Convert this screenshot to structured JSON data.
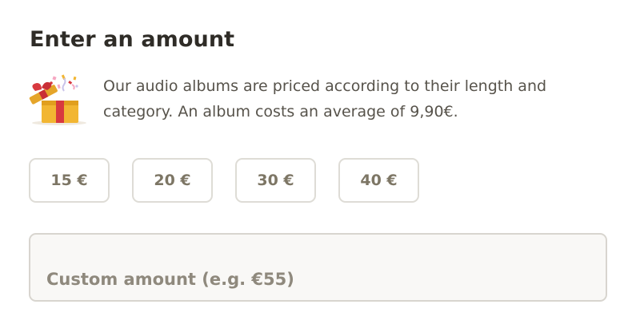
{
  "heading": "Enter an amount",
  "info": {
    "icon": "gift-box-icon",
    "text": "Our audio albums are priced according to their length and category. An album costs an average of 9,90€."
  },
  "amount_options": [
    {
      "label": "15 €"
    },
    {
      "label": "20 €"
    },
    {
      "label": "30 €"
    },
    {
      "label": "40 €"
    }
  ],
  "custom_amount": {
    "value": "",
    "placeholder": "Custom amount (e.g. €55)"
  },
  "colors": {
    "title_text": "#2f2c27",
    "body_text": "#57534b",
    "button_text": "#7d7665",
    "border": "#dedcd6",
    "input_background": "#f9f8f6",
    "gift_box": "#f2b632",
    "gift_ribbon": "#d8393f"
  }
}
